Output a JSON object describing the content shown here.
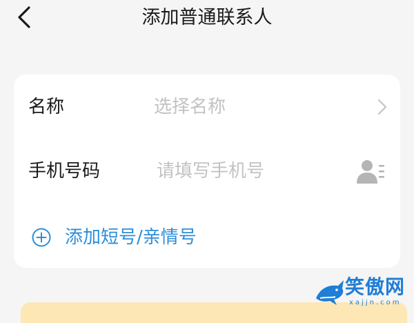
{
  "header": {
    "title": "添加普通联系人",
    "back_icon": "chevron-left-icon"
  },
  "form": {
    "name_row": {
      "label": "名称",
      "placeholder": "选择名称",
      "icon": "chevron-right-icon"
    },
    "phone_row": {
      "label": "手机号码",
      "placeholder": "请填写手机号",
      "value": "",
      "icon": "contact-book-icon"
    },
    "add_short_number": {
      "label": "添加短号/亲情号",
      "icon": "plus-circle-icon"
    }
  },
  "watermark": {
    "text": "笑傲网",
    "subtext": "xajjn.com"
  },
  "colors": {
    "background": "#f5f5f5",
    "card": "#ffffff",
    "accent": "#2c8ed9",
    "placeholder": "#c2c2c2",
    "banner": "#fde7b5"
  }
}
